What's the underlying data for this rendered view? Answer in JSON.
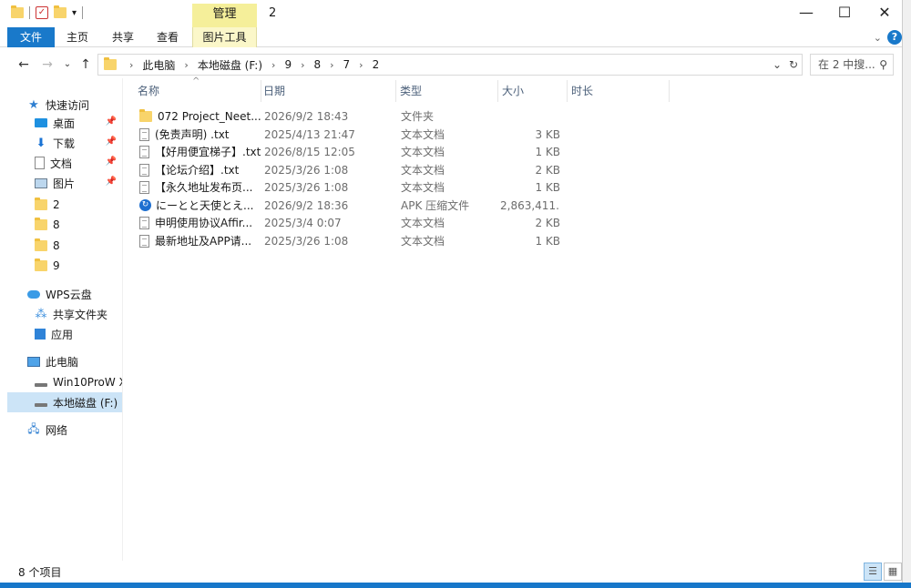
{
  "window": {
    "title": "2",
    "manage_tab": "管理",
    "controls": {
      "minimize": "—",
      "maximize": "☐",
      "close": "✕"
    }
  },
  "ribbon": {
    "tabs": [
      "文件",
      "主页",
      "共享",
      "查看",
      "图片工具"
    ]
  },
  "address": {
    "crumbs": [
      "此电脑",
      "本地磁盘 (F:)",
      "9",
      "8",
      "7",
      "2"
    ],
    "search_placeholder": "在 2 中搜..."
  },
  "nav": {
    "quick_access": "快速访问",
    "items": [
      {
        "label": "桌面",
        "pinned": true
      },
      {
        "label": "下载",
        "pinned": true
      },
      {
        "label": "文档",
        "pinned": true
      },
      {
        "label": "图片",
        "pinned": true
      },
      {
        "label": "2"
      },
      {
        "label": "8"
      },
      {
        "label": "8"
      },
      {
        "label": "9"
      }
    ],
    "wps": "WPS云盘",
    "shared": "共享文件夹",
    "apps": "应用",
    "this_pc": "此电脑",
    "drive1": "Win10ProW X",
    "drive2": "本地磁盘 (F:)",
    "network": "网络"
  },
  "columns": {
    "name": "名称",
    "date": "日期",
    "type": "类型",
    "size": "大小",
    "duration": "时长"
  },
  "files": [
    {
      "name": "072 Project_Neet...",
      "date": "2026/9/2 18:43",
      "type": "文件夹",
      "size": "",
      "icon": "folder-icon"
    },
    {
      "name": "(免责声明) .txt",
      "date": "2025/4/13 21:47",
      "type": "文本文档",
      "size": "3 KB",
      "icon": "text-file-icon"
    },
    {
      "name": "【好用便宜梯子】.txt",
      "date": "2026/8/15 12:05",
      "type": "文本文档",
      "size": "1 KB",
      "icon": "text-file-icon"
    },
    {
      "name": "【论坛介绍】.txt",
      "date": "2025/3/26 1:08",
      "type": "文本文档",
      "size": "2 KB",
      "icon": "text-file-icon"
    },
    {
      "name": "【永久地址发布页...",
      "date": "2025/3/26 1:08",
      "type": "文本文档",
      "size": "1 KB",
      "icon": "text-file-icon"
    },
    {
      "name": "にーとと天使とえ...",
      "date": "2026/9/2 18:36",
      "type": "APK 压缩文件",
      "size": "2,863,411...",
      "icon": "apk-icon"
    },
    {
      "name": "申明使用协议Affir...",
      "date": "2025/3/4 0:07",
      "type": "文本文档",
      "size": "2 KB",
      "icon": "text-file-icon"
    },
    {
      "name": "最新地址及APP请...",
      "date": "2025/3/26 1:08",
      "type": "文本文档",
      "size": "1 KB",
      "icon": "text-file-icon"
    }
  ],
  "status": {
    "count": "8 个项目"
  }
}
